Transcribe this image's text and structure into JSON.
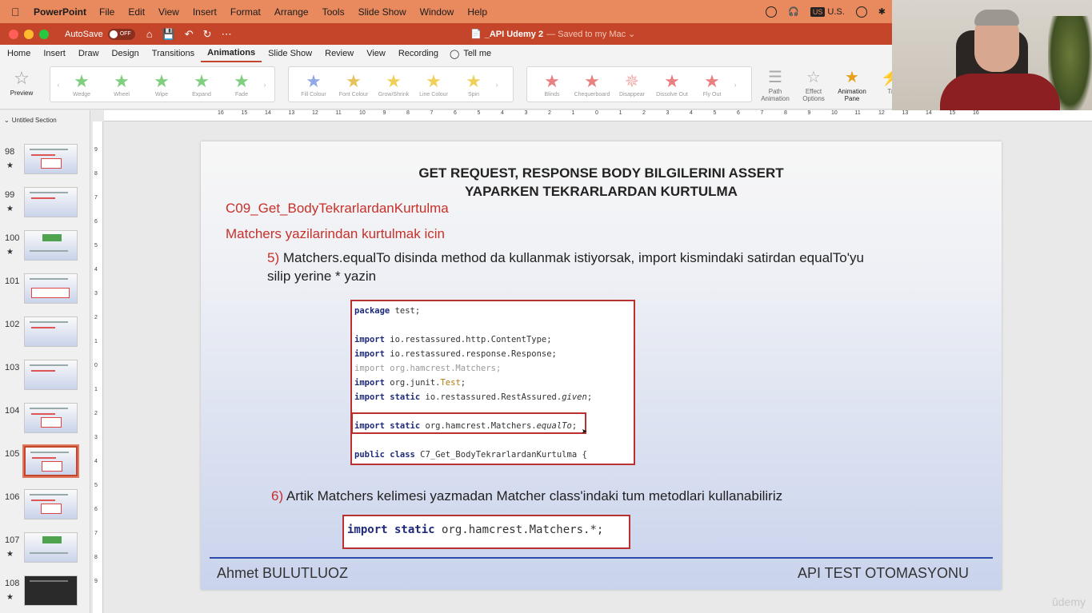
{
  "menubar": {
    "app_name": "PowerPoint",
    "items": [
      "File",
      "Edit",
      "View",
      "Insert",
      "Format",
      "Arrange",
      "Tools",
      "Slide Show",
      "Window",
      "Help"
    ],
    "keyboard_badge": "US",
    "keyboard_label": "U.S."
  },
  "titlebar": {
    "autosave_label": "AutoSave",
    "autosave_state": "OFF",
    "doc_name": "_API Udemy 2",
    "saved_status": "— Saved to my Mac ⌄"
  },
  "ribbon_tabs": [
    "Home",
    "Insert",
    "Draw",
    "Design",
    "Transitions",
    "Animations",
    "Slide Show",
    "Review",
    "View",
    "Recording"
  ],
  "tell_me": "Tell me",
  "ribbon": {
    "preview_label": "Preview",
    "entrance": [
      {
        "label": "Wedge",
        "color": "#7fcf7f"
      },
      {
        "label": "Wheel",
        "color": "#7fcf7f"
      },
      {
        "label": "Wipe",
        "color": "#7fcf7f"
      },
      {
        "label": "Expand",
        "color": "#7fcf7f"
      },
      {
        "label": "Fade",
        "color": "#7fcf7f"
      }
    ],
    "emphasis": [
      {
        "label": "Fill Colour",
        "color": "#8fa8e6"
      },
      {
        "label": "Font Colour",
        "color": "#e6c25a"
      },
      {
        "label": "Grow/Shrink",
        "color": "#f0cf5a"
      },
      {
        "label": "Line Colour",
        "color": "#f0cf5a"
      },
      {
        "label": "Spin",
        "color": "#f0cf5a"
      }
    ],
    "exit": [
      {
        "label": "Blinds",
        "color": "#e88080"
      },
      {
        "label": "Chequerboard",
        "color": "#e88080"
      },
      {
        "label": "Disappear",
        "color": "#f0b0b0"
      },
      {
        "label": "Dissolve Out",
        "color": "#e88080"
      },
      {
        "label": "Fly Out",
        "color": "#e88080"
      }
    ],
    "tools": [
      {
        "label": "Path Animation"
      },
      {
        "label": "Effect Options"
      },
      {
        "label": "Animation Pane"
      },
      {
        "label": "Tr"
      }
    ]
  },
  "slide_panel": {
    "section": "Untitled Section",
    "slides": [
      {
        "num": "98",
        "star": "★"
      },
      {
        "num": "99",
        "star": "★"
      },
      {
        "num": "100",
        "star": "★"
      },
      {
        "num": "101",
        "star": ""
      },
      {
        "num": "102",
        "star": ""
      },
      {
        "num": "103",
        "star": ""
      },
      {
        "num": "104",
        "star": ""
      },
      {
        "num": "105",
        "star": ""
      },
      {
        "num": "106",
        "star": ""
      },
      {
        "num": "107",
        "star": "★"
      },
      {
        "num": "108",
        "star": "★"
      }
    ],
    "selected": "105"
  },
  "ruler_h": [
    "16",
    "15",
    "14",
    "13",
    "12",
    "11",
    "10",
    "9",
    "8",
    "7",
    "6",
    "5",
    "4",
    "3",
    "2",
    "1",
    "0",
    "1",
    "2",
    "3",
    "4",
    "5",
    "6",
    "7",
    "8",
    "9",
    "10",
    "11",
    "12",
    "13",
    "14",
    "15",
    "16"
  ],
  "ruler_v": [
    "9",
    "8",
    "7",
    "6",
    "5",
    "4",
    "3",
    "2",
    "1",
    "0",
    "1",
    "2",
    "3",
    "4",
    "5",
    "6",
    "7",
    "8",
    "9"
  ],
  "slide": {
    "title_line1": "GET REQUEST, RESPONSE BODY BILGILERINI ASSERT",
    "title_line2": "YAPARKEN TEKRARLARDAN KURTULMA",
    "subtitle1": "C09_Get_BodyTekrarlardanKurtulma",
    "subtitle2": "Matchers yazilarindan kurtulmak icin",
    "step5_num": "5)",
    "step5_text": "Matchers.equalTo disinda method da kullanmak istiyorsak, import kismindaki satirdan equalTo'yu silip yerine * yazin",
    "code": {
      "l1_kw": "package",
      "l1_rest": " test;",
      "l3_kw": "import",
      "l3_rest": " io.restassured.http.ContentType;",
      "l4_kw": "import",
      "l4_rest": " io.restassured.response.Response;",
      "l5": "import org.hamcrest.Matchers;",
      "l6_kw": "import",
      "l6_a": " org.junit.",
      "l6_b": "Test",
      "l6_c": ";",
      "l7_kw": "import static",
      "l7_rest": " io.restassured.RestAssured.",
      "l7_it": "given",
      "l7_end": ";",
      "l9_kw": "import static",
      "l9_rest": " org.hamcrest.Matchers.",
      "l9_it": "equalTo",
      "l9_end": ";",
      "l11_kw": "public class",
      "l11_rest": " C7_Get_BodyTekrarlardanKurtulma {"
    },
    "step6_num": "6)",
    "step6_text": "Artik Matchers kelimesi yazmadan Matcher class'indaki tum metodlari kullanabiliriz",
    "import_kw": "import static",
    "import_rest": " org.hamcrest.Matchers.*;",
    "footer_left": "Ahmet BULUTLUOZ",
    "footer_right": "API TEST OTOMASYONU"
  },
  "watermark": "ûdemy",
  "colors": {
    "menubar": "#e98a5e",
    "titlebar": "#c5452a",
    "accent_red": "#c8302a",
    "code_keyword": "#1e2a78",
    "footer_line": "#2c4aa8"
  }
}
